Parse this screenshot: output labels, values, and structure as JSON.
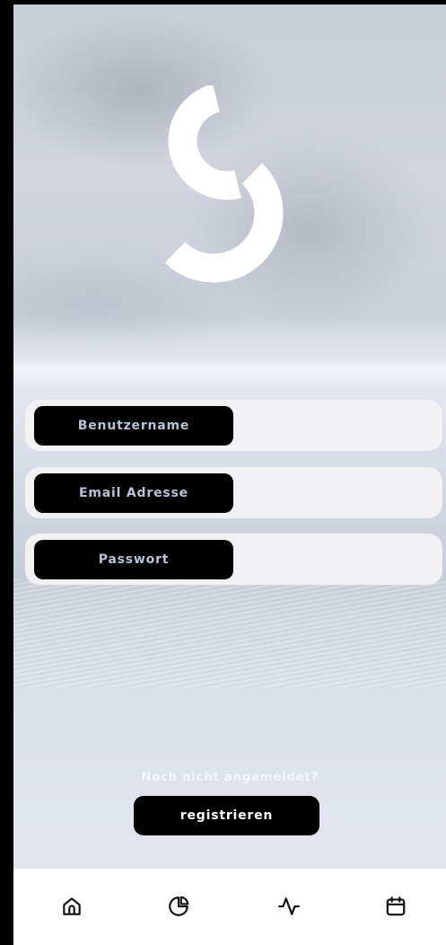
{
  "brand": {
    "logo_icon": "g-logo-icon"
  },
  "form": {
    "fields": [
      {
        "label": "Benutzername",
        "value": ""
      },
      {
        "label": "Email Adresse",
        "value": ""
      },
      {
        "label": "Passwort",
        "value": ""
      }
    ]
  },
  "signup": {
    "prompt": "Noch nicht angemeldet?",
    "button_label": "registrieren"
  },
  "nav": {
    "items": [
      {
        "icon": "home-icon"
      },
      {
        "icon": "pie-chart-icon"
      },
      {
        "icon": "activity-icon"
      },
      {
        "icon": "calendar-icon"
      }
    ]
  }
}
